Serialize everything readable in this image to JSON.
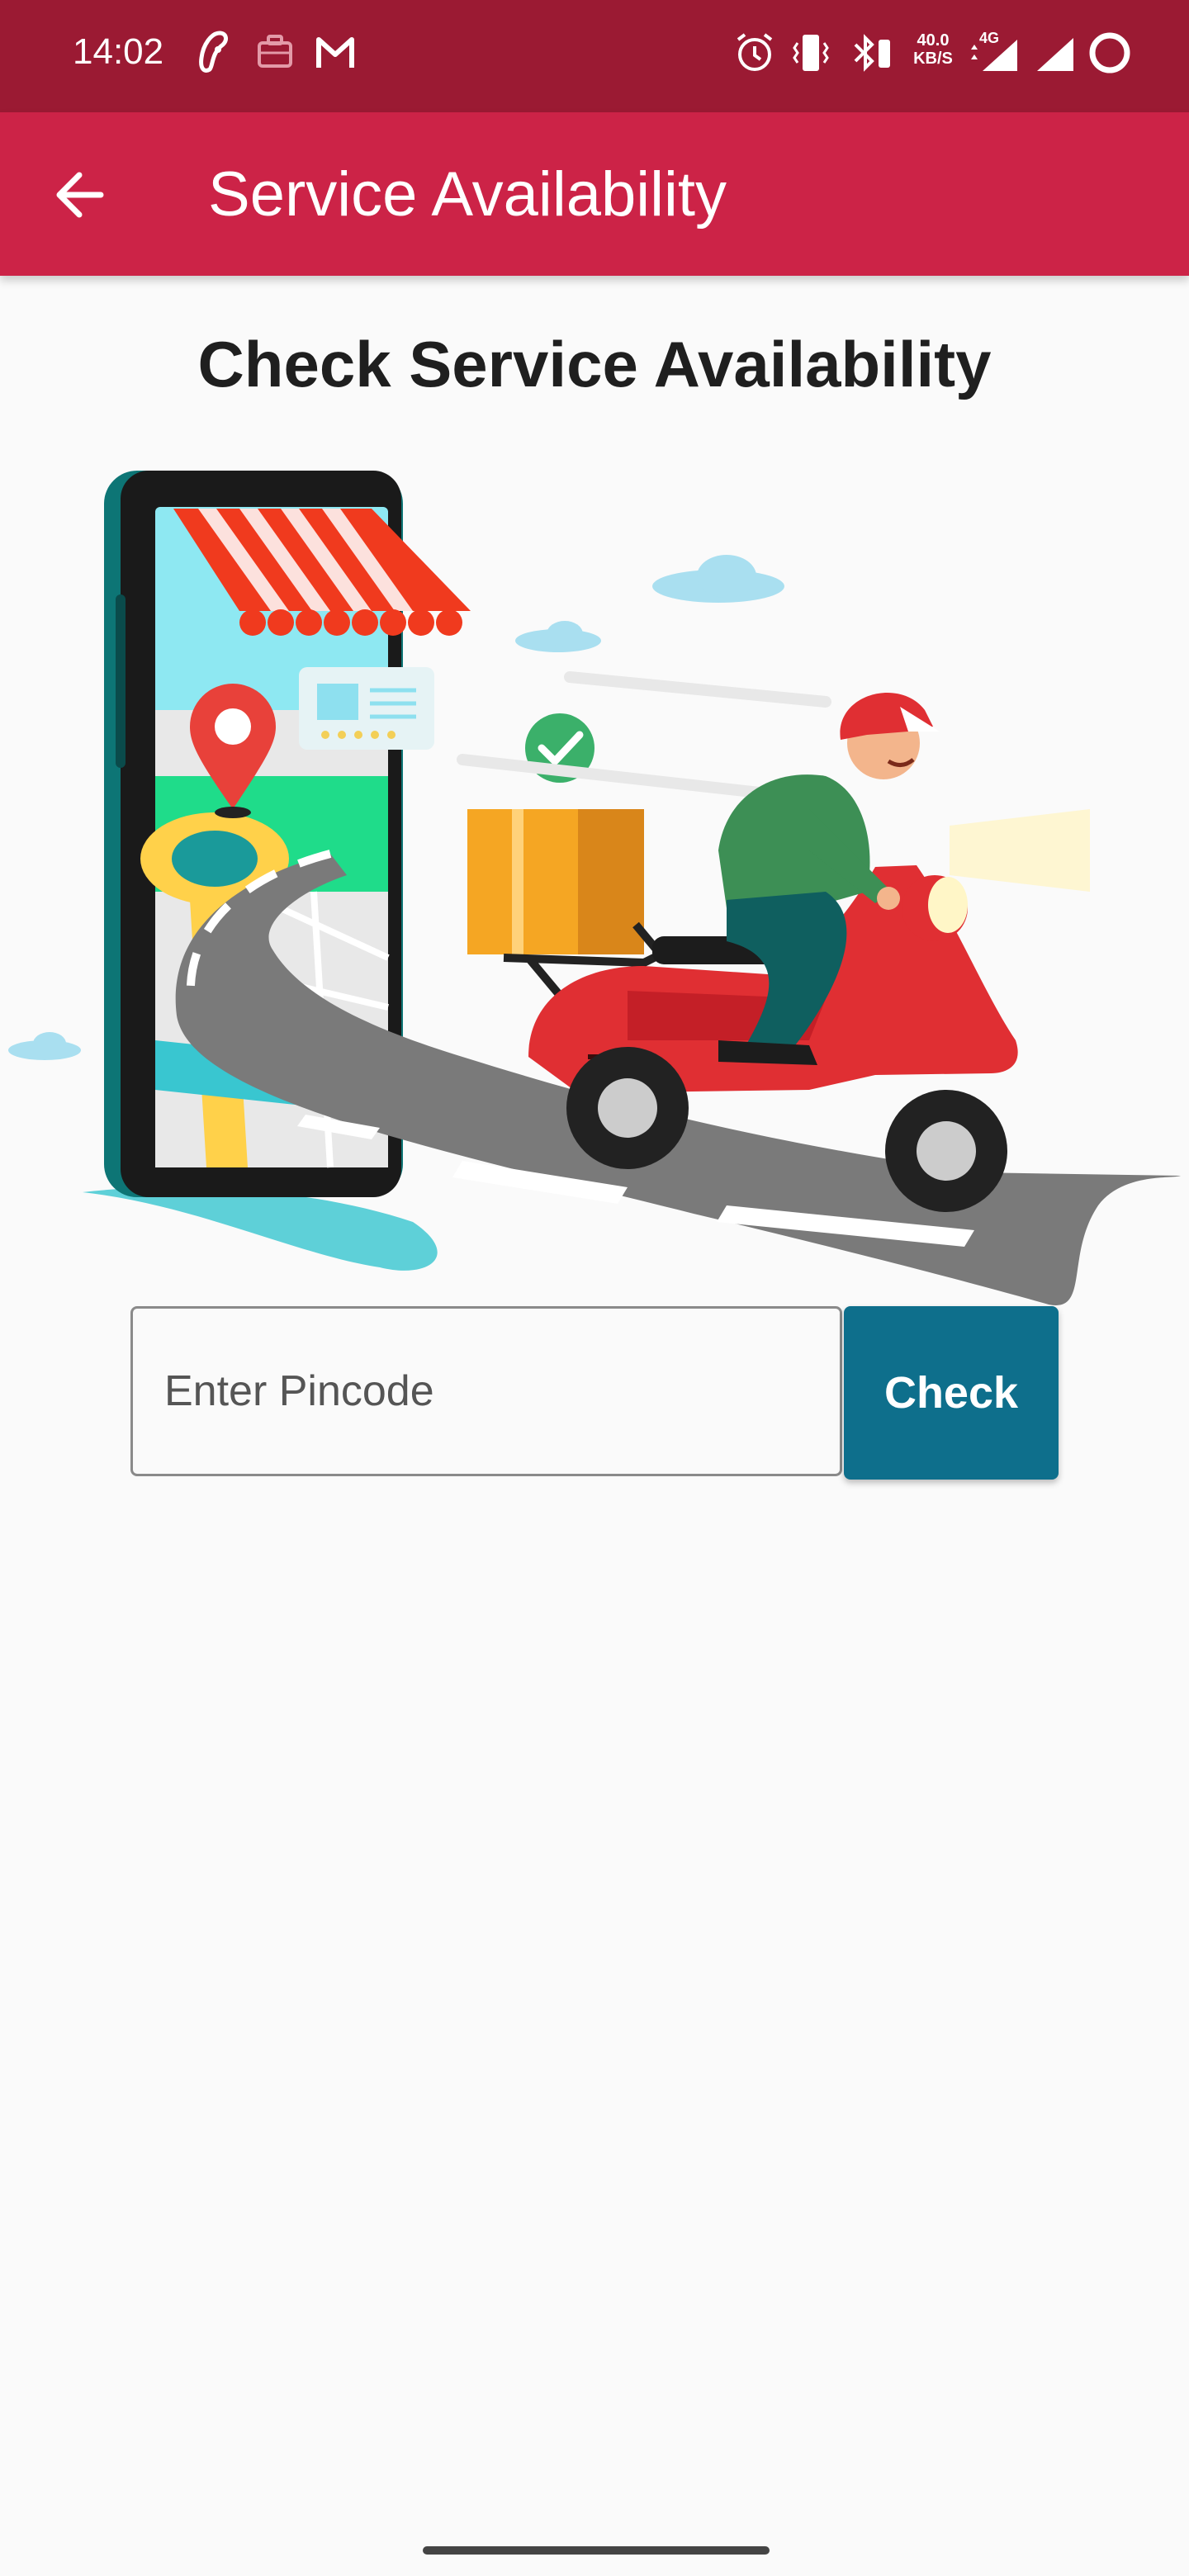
{
  "status_bar": {
    "time": "14:02",
    "net_speed_value": "40.0",
    "net_speed_unit": "KB/S",
    "network_type": "4G",
    "left_icons": [
      "app-notification-icon",
      "briefcase-icon",
      "gmail-icon"
    ],
    "right_icons": [
      "alarm-icon",
      "vibrate-icon",
      "bluetooth-icon",
      "signal-icon",
      "signal-icon",
      "battery-ring-icon"
    ]
  },
  "app_bar": {
    "title": "Service Availability",
    "back_icon": "arrow-left-icon"
  },
  "main": {
    "heading": "Check Service Availability",
    "illustration": "delivery-scooter-illustration",
    "pincode_placeholder": "Enter Pincode",
    "pincode_value": "",
    "check_label": "Check"
  },
  "colors": {
    "status_bar": "#9b1a33",
    "app_bar": "#cc2347",
    "check_button": "#0e6f8c",
    "background": "#fafafa"
  }
}
